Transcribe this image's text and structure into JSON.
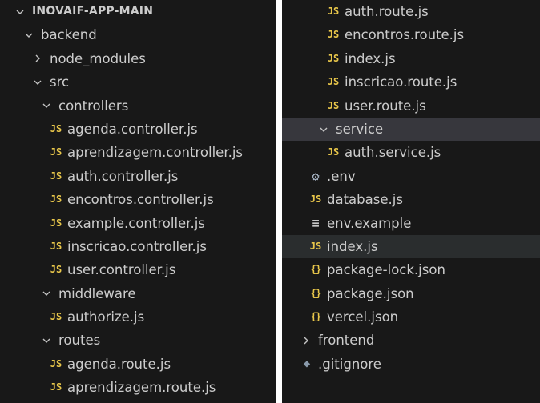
{
  "left_panel": {
    "rows": [
      {
        "label": "INOVAIF-APP-MAIN",
        "type": "folder",
        "open": true,
        "depth": 0,
        "root": true
      },
      {
        "label": "backend",
        "type": "folder",
        "open": true,
        "depth": 1
      },
      {
        "label": "node_modules",
        "type": "folder",
        "open": false,
        "depth": 2
      },
      {
        "label": "src",
        "type": "folder",
        "open": true,
        "depth": 2
      },
      {
        "label": "controllers",
        "type": "folder",
        "open": true,
        "depth": 3
      },
      {
        "label": "agenda.controller.js",
        "type": "js",
        "depth": 4
      },
      {
        "label": "aprendizagem.controller.js",
        "type": "js",
        "depth": 4
      },
      {
        "label": "auth.controller.js",
        "type": "js",
        "depth": 4
      },
      {
        "label": "encontros.controller.js",
        "type": "js",
        "depth": 4
      },
      {
        "label": "example.controller.js",
        "type": "js",
        "depth": 4
      },
      {
        "label": "inscricao.controller.js",
        "type": "js",
        "depth": 4
      },
      {
        "label": "user.controller.js",
        "type": "js",
        "depth": 4
      },
      {
        "label": "middleware",
        "type": "folder",
        "open": true,
        "depth": 3
      },
      {
        "label": "authorize.js",
        "type": "js",
        "depth": 4
      },
      {
        "label": "routes",
        "type": "folder",
        "open": true,
        "depth": 3
      },
      {
        "label": "agenda.route.js",
        "type": "js",
        "depth": 4
      },
      {
        "label": "aprendizagem.route.js",
        "type": "js",
        "depth": 4
      }
    ]
  },
  "right_panel": {
    "rows": [
      {
        "label": "auth.route.js",
        "type": "js",
        "depth": 4
      },
      {
        "label": "encontros.route.js",
        "type": "js",
        "depth": 4
      },
      {
        "label": "index.js",
        "type": "js",
        "depth": 4
      },
      {
        "label": "inscricao.route.js",
        "type": "js",
        "depth": 4
      },
      {
        "label": "user.route.js",
        "type": "js",
        "depth": 4
      },
      {
        "label": "service",
        "type": "folder",
        "open": true,
        "depth": 3,
        "highlight": "selected"
      },
      {
        "label": "auth.service.js",
        "type": "js",
        "depth": 4
      },
      {
        "label": ".env",
        "type": "gear",
        "depth": 2
      },
      {
        "label": "database.js",
        "type": "js",
        "depth": 2
      },
      {
        "label": "env.example",
        "type": "lines",
        "depth": 2
      },
      {
        "label": "index.js",
        "type": "js",
        "depth": 2,
        "highlight": "active"
      },
      {
        "label": "package-lock.json",
        "type": "json",
        "depth": 2
      },
      {
        "label": "package.json",
        "type": "json",
        "depth": 2
      },
      {
        "label": "vercel.json",
        "type": "json",
        "depth": 2
      },
      {
        "label": "frontend",
        "type": "folder",
        "open": false,
        "depth": 1
      },
      {
        "label": ".gitignore",
        "type": "git",
        "depth": 1
      }
    ]
  },
  "icons": {
    "js": "JS",
    "json": "{}",
    "gear": "⚙",
    "lines": "≡",
    "git": "◆"
  },
  "colors": {
    "background": "#181818",
    "text": "#cccccc",
    "js_icon": "#e8c64a",
    "selected_row": "#37373d"
  }
}
